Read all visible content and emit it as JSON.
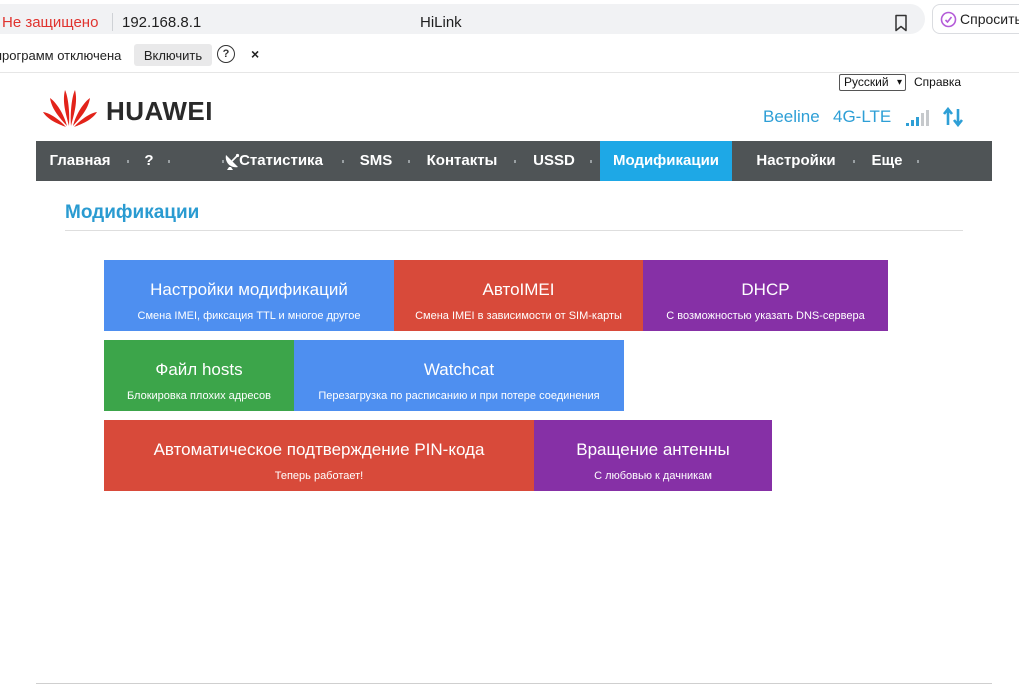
{
  "browser": {
    "security_status": "Не защищено",
    "url": "192.168.8.1",
    "tab_title": "HiLink",
    "ask_button": "Спросить"
  },
  "infobar": {
    "message": "программ отключена",
    "enable_button": "Включить",
    "help_icon": "?",
    "close_icon": "×"
  },
  "header": {
    "language": "Русский",
    "help_link": "Справка",
    "brand": "HUAWEI",
    "operator": "Beeline",
    "network_type": "4G-LTE",
    "icons": [
      "signal-bars-icon",
      "data-transfer-icon"
    ],
    "colors": {
      "accent": "#1ea8e6",
      "nav_bg": "#4f5456",
      "title": "#2a9bd1"
    }
  },
  "nav": {
    "items": [
      {
        "label": "Главная"
      },
      {
        "label": "?"
      },
      {
        "label": "Статистика"
      },
      {
        "label": "SMS"
      },
      {
        "label": "Контакты"
      },
      {
        "label": "USSD"
      },
      {
        "label": "Модификации",
        "active": true
      },
      {
        "label": "Настройки"
      },
      {
        "label": "Еще"
      }
    ]
  },
  "main": {
    "title": "Модификации",
    "tiles": [
      {
        "title": "Настройки модификаций",
        "subtitle": "Смена IMEI, фиксация TTL и многое другое",
        "color": "#4e8ff0"
      },
      {
        "title": "АвтоIMEI",
        "subtitle": "Смена IMEI в зависимости от SIM-карты",
        "color": "#d84a3a"
      },
      {
        "title": "DHCP",
        "subtitle": "С возможностью указать DNS-сервера",
        "color": "#8630a6"
      },
      {
        "title": "Файл hosts",
        "subtitle": "Блокировка плохих адресов",
        "color": "#3ca54a"
      },
      {
        "title": "Watchcat",
        "subtitle": "Перезагрузка по расписанию и при потере соединения",
        "color": "#4e8ff0"
      },
      {
        "title": "Автоматическое подтверждение PIN-кода",
        "subtitle": "Теперь работает!",
        "color": "#d84a3a"
      },
      {
        "title": "Вращение антенны",
        "subtitle": "С любовью к дачникам",
        "color": "#8630a6"
      }
    ]
  }
}
